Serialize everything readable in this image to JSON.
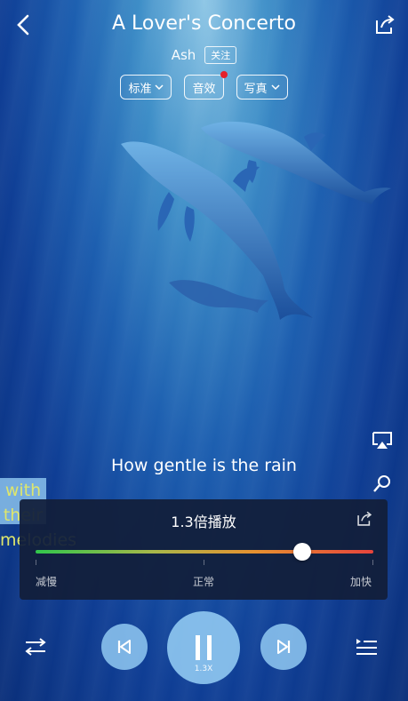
{
  "header": {
    "title": "A Lover's Concerto",
    "artist": "Ash",
    "follow_label": "关注",
    "chips": [
      {
        "label": "标准",
        "has_dropdown": true,
        "has_badge": false
      },
      {
        "label": "音效",
        "has_dropdown": false,
        "has_badge": true
      },
      {
        "label": "写真",
        "has_dropdown": true,
        "has_badge": false
      }
    ]
  },
  "lyrics": {
    "current": "How gentle is the rain",
    "next": "with their melodies"
  },
  "speed_panel": {
    "title": "1.3倍播放",
    "labels": {
      "slow": "减慢",
      "normal": "正常",
      "fast": "加快"
    },
    "speed_level": 0.79
  },
  "controls": {
    "speed_badge": "1.3X"
  },
  "colors": {
    "badge_red": "#e5202a",
    "control_blue": "#90c9f2",
    "panel_bg": "#121f3a",
    "lyric_highlight": "#eaf06a"
  },
  "icons": [
    "back-icon",
    "share-icon",
    "chevron-down-icon",
    "airplay-icon",
    "microphone-icon",
    "loop-icon",
    "previous-icon",
    "pause-icon",
    "next-icon",
    "playlist-icon"
  ]
}
